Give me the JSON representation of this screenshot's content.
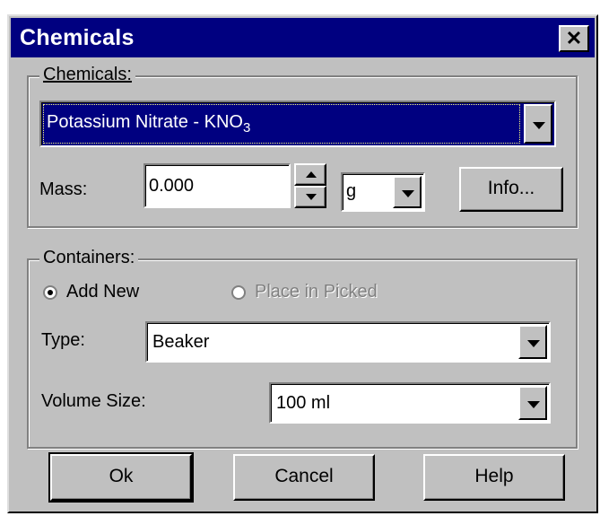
{
  "window": {
    "title": "Chemicals",
    "close_glyph": "✕"
  },
  "chemicals_group": {
    "legend": "Chemicals:",
    "selected_chemical": "Potassium Nitrate - KNO",
    "selected_chemical_subscript": "3",
    "mass_label": "Mass:",
    "mass_value": "0.000",
    "unit_value": "g",
    "info_button": "Info..."
  },
  "containers_group": {
    "legend": "Containers:",
    "radio_add_new": "Add New",
    "radio_place_in_picked": "Place in Picked",
    "add_new_selected": true,
    "type_label": "Type:",
    "type_value": "Beaker",
    "volume_label": "Volume Size:",
    "volume_value": "100 ml"
  },
  "buttons": {
    "ok": "Ok",
    "cancel": "Cancel",
    "help": "Help"
  },
  "colors": {
    "titlebar": "#000080",
    "face": "#c0c0c0",
    "selection": "#000080"
  }
}
